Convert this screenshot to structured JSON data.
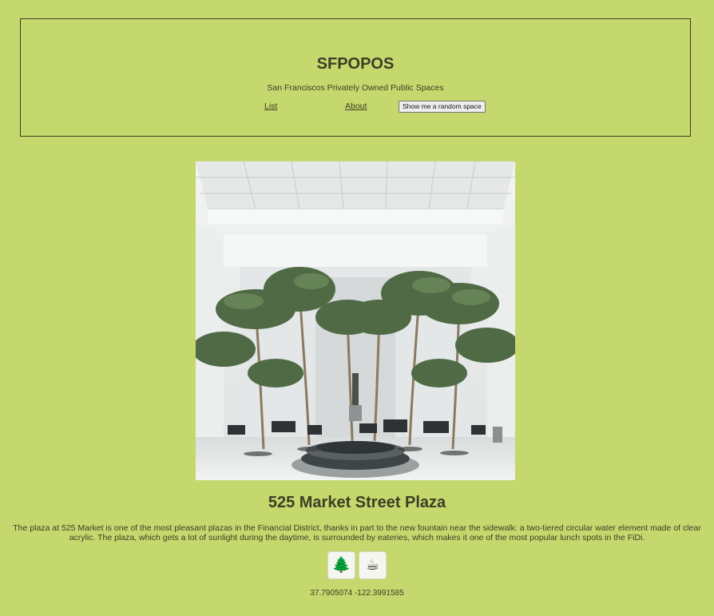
{
  "site": {
    "title": "SFPOPOS",
    "subtitle": "San Franciscos Privately Owned Public Spaces"
  },
  "nav": {
    "list_label": "List",
    "about_label": "About",
    "random_button_label": "Show me a random space"
  },
  "space": {
    "title": "525 Market Street Plaza",
    "description": "The plaza at 525 Market is one of the most pleasant plazas in the Financial District, thanks in part to the new fountain near the sidewalk: a two-tiered circular water element made of clear acrylic. The plaza, which gets a lot of sunlight during the daytime, is surrounded by eateries, which makes it one of the most popular lunch spots in the FiDi.",
    "features": [
      {
        "icon": "tree-icon",
        "glyph": "🌲"
      },
      {
        "icon": "coffee-icon",
        "glyph": "☕"
      }
    ],
    "coordinates": "37.7905074 -122.3991585"
  },
  "colors": {
    "background": "#c5d86d",
    "text": "#3b3e24",
    "border": "#3a3d25"
  }
}
